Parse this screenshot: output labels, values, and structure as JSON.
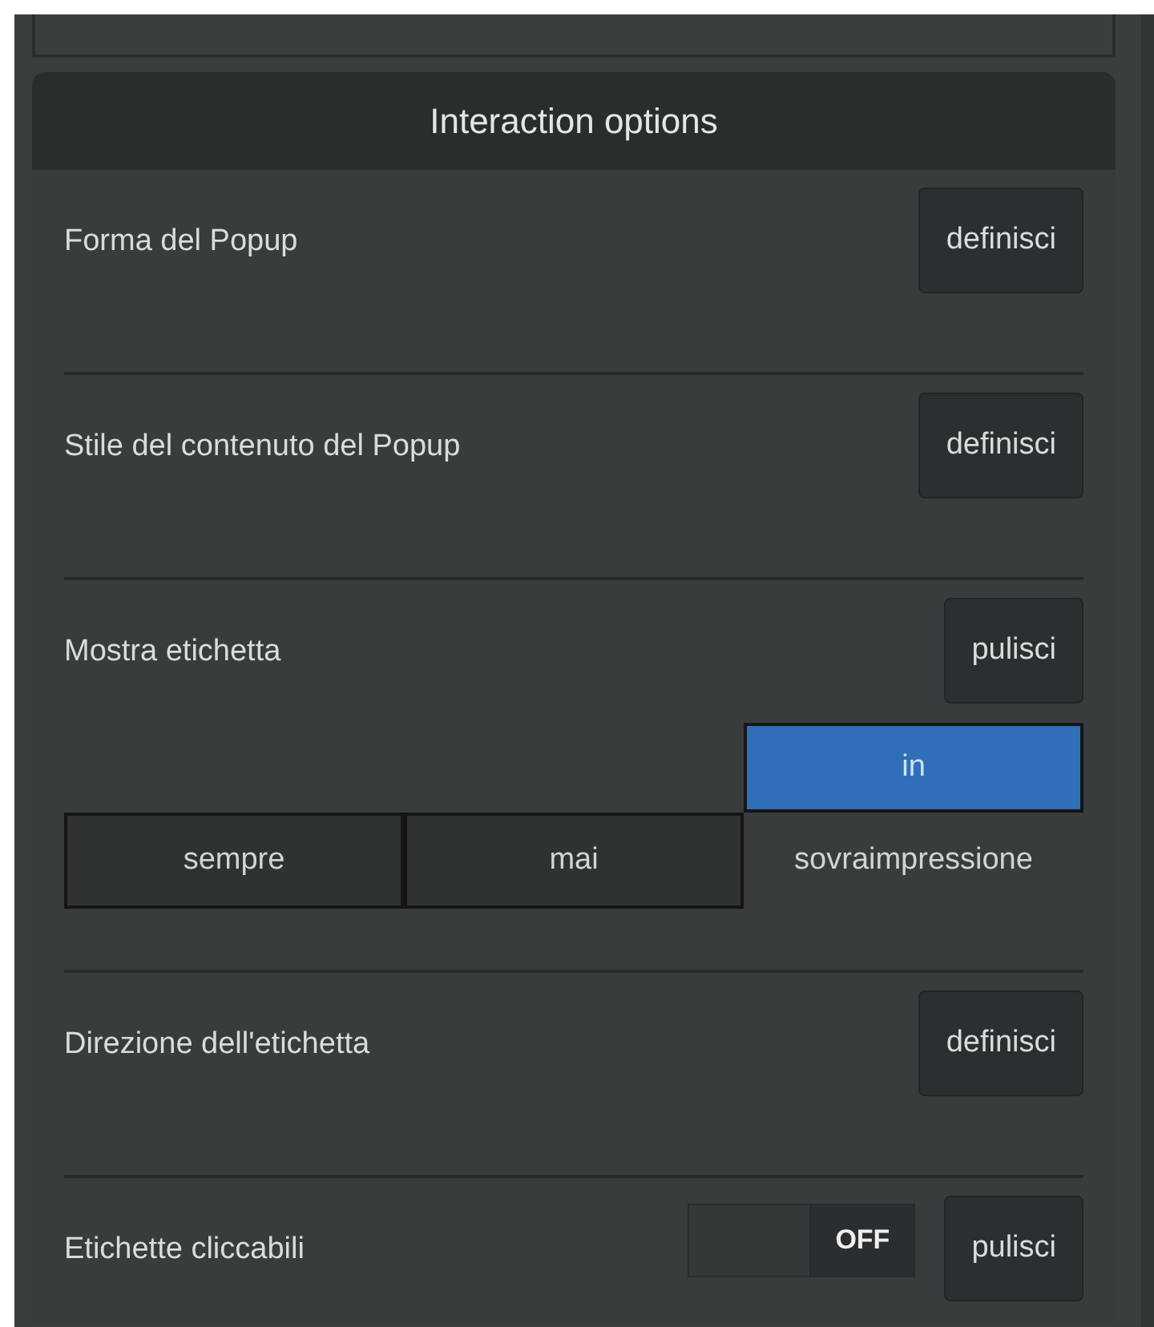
{
  "panel": {
    "title": "Interaction options"
  },
  "rows": [
    {
      "kind": "button",
      "label": "Forma del Popup",
      "button": "definisci"
    },
    {
      "kind": "button",
      "label": "Stile del contenuto del Popup",
      "button": "definisci"
    },
    {
      "kind": "choice",
      "label": "Mostra etichetta",
      "button": "pulisci",
      "options": [
        {
          "label": "sempre",
          "selected": false
        },
        {
          "label": "mai",
          "selected": false
        },
        {
          "label": "in",
          "label_overflow": "sovraimpressione",
          "selected": true
        }
      ]
    },
    {
      "kind": "button",
      "label": "Direzione dell'etichetta",
      "button": "definisci"
    },
    {
      "kind": "toggle",
      "label": "Etichette cliccabili",
      "button": "pulisci",
      "toggle": {
        "on": false,
        "label": "OFF"
      }
    }
  ]
}
